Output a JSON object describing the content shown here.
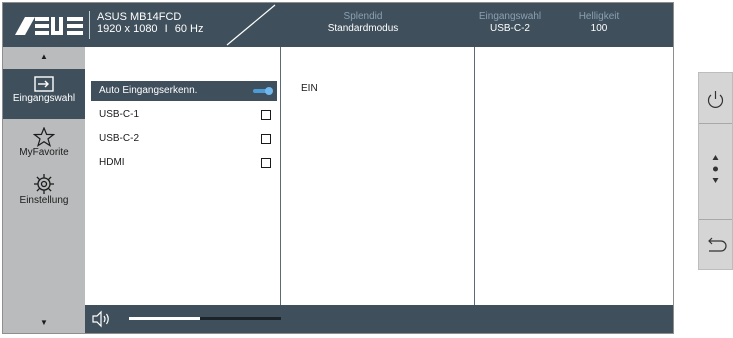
{
  "header": {
    "model": "ASUS MB14FCD",
    "resolution": "1920 x 1080",
    "separator": "I",
    "refresh": "60 Hz",
    "splendid_label": "Splendid",
    "splendid_value": "Standardmodus",
    "input_label": "Eingangswahl",
    "input_value": "USB-C-2",
    "brightness_label": "Helligkeit",
    "brightness_value": "100",
    "logo_icon": "asus-logo"
  },
  "nav": {
    "items": [
      {
        "label": "Eingangswahl",
        "icon": "input-select-icon",
        "active": true
      },
      {
        "label": "MyFavorite",
        "icon": "star-icon",
        "active": false
      },
      {
        "label": "Einstellung",
        "icon": "gear-icon",
        "active": false
      }
    ],
    "up_icon": "arrow-up-icon",
    "down_icon": "arrow-down-icon"
  },
  "options": [
    {
      "label": "Auto Eingangserkenn.",
      "control": "toggle",
      "state": "on"
    },
    {
      "label": "USB-C-1",
      "control": "checkbox",
      "checked": false
    },
    {
      "label": "USB-C-2",
      "control": "checkbox",
      "checked": false
    },
    {
      "label": "HDMI",
      "control": "checkbox",
      "checked": false
    }
  ],
  "submenu": {
    "value": "EIN"
  },
  "volume": {
    "icon": "speaker-icon",
    "level_fraction": 0.47
  },
  "side_buttons": [
    {
      "icon": "power-icon"
    },
    {
      "icon": "joystick-icon"
    },
    {
      "icon": "back-icon"
    }
  ],
  "colors": {
    "header_bg": "#3f4f5c",
    "nav_bg": "#b9bbbc",
    "toggle_on": "#4c9ad6"
  }
}
